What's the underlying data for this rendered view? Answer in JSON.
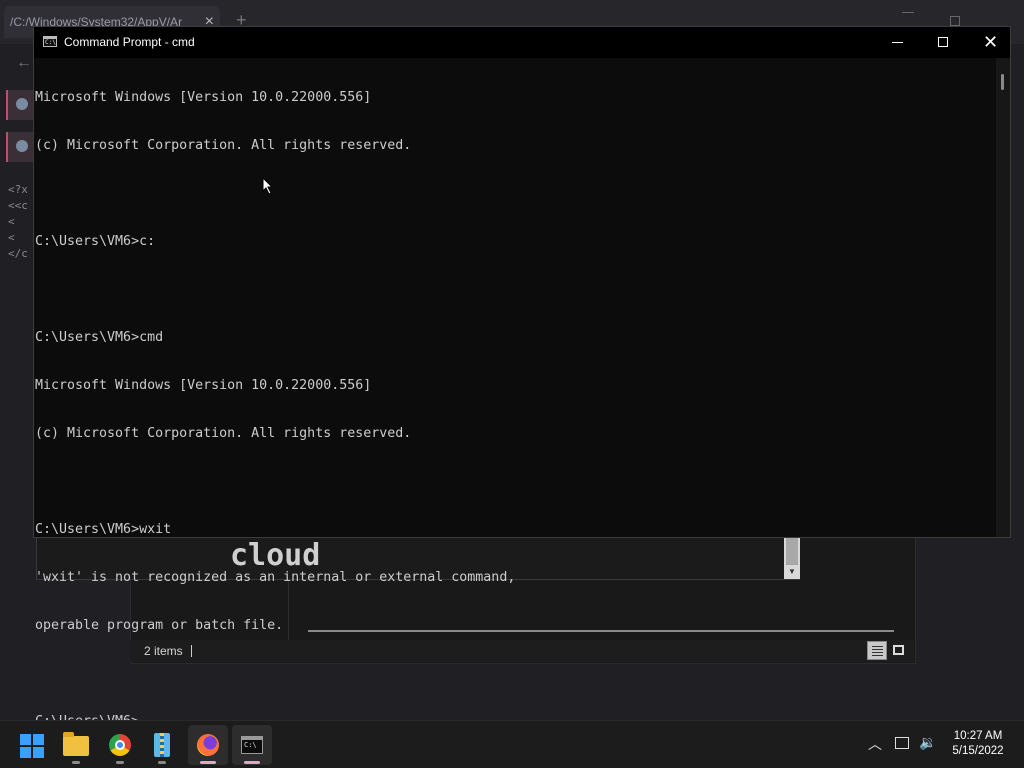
{
  "background_browser": {
    "tab_title": "/C:/Windows/System32/AppV/Ar",
    "tab_close": "×",
    "new_tab": "+",
    "code_lines": [
      "<?x",
      "<<c",
      "  <",
      "  <",
      "</c"
    ]
  },
  "explorer": {
    "preview_text": "cloud",
    "status_items": "2 items"
  },
  "cmd_window": {
    "title": "Command Prompt - cmd",
    "close_glyph": "✕",
    "console_lines": [
      "Microsoft Windows [Version 10.0.22000.556]",
      "(c) Microsoft Corporation. All rights reserved.",
      "",
      "C:\\Users\\VM6>c:",
      "",
      "C:\\Users\\VM6>cmd",
      "Microsoft Windows [Version 10.0.22000.556]",
      "(c) Microsoft Corporation. All rights reserved.",
      "",
      "C:\\Users\\VM6>wxit",
      "'wxit' is not recognized as an internal or external command,",
      "operable program or batch file.",
      "",
      "C:\\Users\\VM6>"
    ]
  },
  "taskbar": {
    "apps": [
      {
        "name": "start",
        "icon": "windows-logo-icon"
      },
      {
        "name": "file-explorer",
        "icon": "folder-icon"
      },
      {
        "name": "chrome",
        "icon": "chrome-icon"
      },
      {
        "name": "archive-app",
        "icon": "zip-icon"
      },
      {
        "name": "firefox",
        "icon": "firefox-icon",
        "active": true
      },
      {
        "name": "command-prompt",
        "icon": "terminal-icon",
        "active": true
      }
    ],
    "tray": {
      "chevron": "^",
      "volume": "🔊",
      "time": "10:27 AM",
      "date": "5/15/2022"
    }
  },
  "colors": {
    "console_text": "#cccccc",
    "console_bg": "#0c0c0c",
    "accent_start": "#3aa0ff"
  }
}
